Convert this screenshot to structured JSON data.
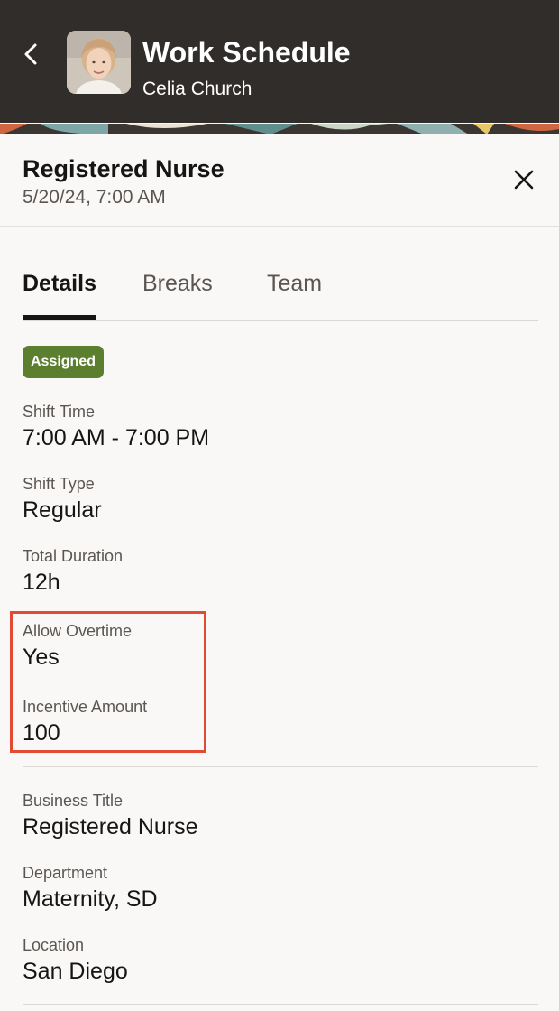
{
  "header": {
    "title": "Work Schedule",
    "subtitle": "Celia Church",
    "back_icon": "chevron-left-icon",
    "background_color": "#312d2a"
  },
  "shift": {
    "title": "Registered Nurse",
    "date": "5/20/24, 7:00 AM",
    "close_icon": "close-icon"
  },
  "tabs": [
    {
      "label": "Details",
      "active": true
    },
    {
      "label": "Breaks",
      "active": false
    },
    {
      "label": "Team",
      "active": false
    }
  ],
  "status_badge": {
    "label": "Assigned",
    "color": "#5b7f2f"
  },
  "fields": {
    "shift_time": {
      "label": "Shift Time",
      "value": "7:00 AM - 7:00 PM"
    },
    "shift_type": {
      "label": "Shift Type",
      "value": "Regular"
    },
    "total_duration": {
      "label": "Total Duration",
      "value": "12h"
    },
    "allow_overtime": {
      "label": "Allow Overtime",
      "value": "Yes"
    },
    "incentive_amount": {
      "label": "Incentive Amount",
      "value": "100"
    },
    "business_title": {
      "label": "Business Title",
      "value": "Registered Nurse"
    },
    "department": {
      "label": "Department",
      "value": "Maternity, SD"
    },
    "location": {
      "label": "Location",
      "value": "San Diego"
    }
  },
  "highlight_color": "#e24a33"
}
